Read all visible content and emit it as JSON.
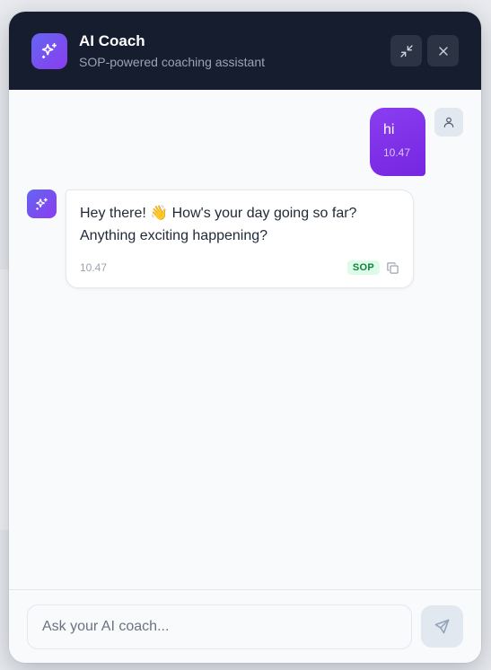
{
  "header": {
    "title": "AI Coach",
    "subtitle": "SOP-powered coaching assistant",
    "logo_icon": "sparkles-icon",
    "minimize_icon": "minimize-icon",
    "close_icon": "close-icon"
  },
  "messages": {
    "user": {
      "text": "hi",
      "time": "10.47",
      "avatar_icon": "user-icon"
    },
    "assistant": {
      "text": "Hey there! 👋 How's your day going so far? Anything exciting happening?",
      "time": "10.47",
      "badge": "SOP",
      "avatar_icon": "sparkles-icon",
      "copy_icon": "copy-icon"
    }
  },
  "composer": {
    "placeholder": "Ask your AI coach...",
    "value": "",
    "send_icon": "send-icon"
  },
  "colors": {
    "header_bg": "#161d2e",
    "user_bubble": "#7c2ee6",
    "accent_gradient_start": "#6366f1",
    "accent_gradient_end": "#8b3cf0",
    "sop_badge_bg": "#dcfce7",
    "sop_badge_text": "#15803d"
  }
}
